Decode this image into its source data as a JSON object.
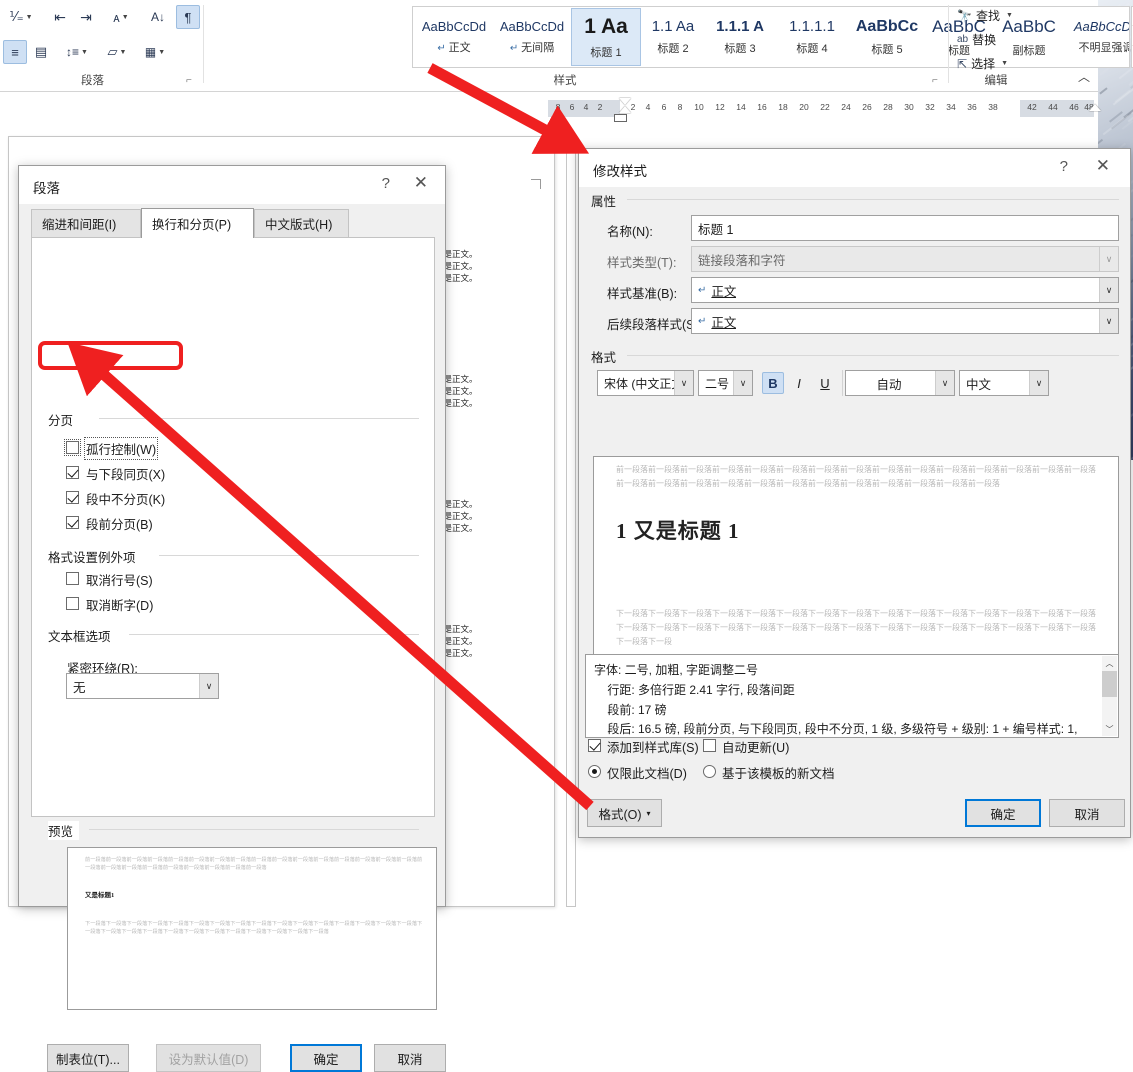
{
  "ribbon": {
    "paragraph_group": {
      "label": "段落",
      "dialog_launcher": "dialog-launcher",
      "buttons": [
        {
          "name": "multilevel-list",
          "glyph": "≔"
        },
        {
          "name": "decrease-indent",
          "glyph": "⇤"
        },
        {
          "name": "increase-indent",
          "glyph": "⇥"
        },
        {
          "name": "asian-layout",
          "glyph": "文"
        },
        {
          "name": "sort",
          "glyph": "A↓"
        },
        {
          "name": "show-formatting-marks",
          "glyph": "¶"
        },
        {
          "name": "align-left",
          "glyph": "≡"
        },
        {
          "name": "distributed",
          "glyph": "▤"
        },
        {
          "name": "line-spacing",
          "glyph": "↕"
        },
        {
          "name": "shading",
          "glyph": "▱"
        },
        {
          "name": "borders",
          "glyph": "▦"
        }
      ]
    },
    "styles_group": {
      "label": "样式",
      "dialog_launcher": "dialog-launcher",
      "items": [
        {
          "sample": "AaBbCcDd",
          "name": "正文",
          "mark": "↵",
          "size": 13,
          "weight": "400",
          "style": "normal",
          "active": false
        },
        {
          "sample": "AaBbCcDd",
          "name": "无间隔",
          "mark": "↵",
          "size": 13,
          "weight": "400",
          "style": "normal",
          "active": false
        },
        {
          "sample": "1  Aa",
          "name": "标题 1",
          "mark": "",
          "size": 21,
          "weight": "700",
          "style": "normal",
          "active": true
        },
        {
          "sample": "1.1  Aa",
          "name": "标题 2",
          "mark": "",
          "size": 15,
          "weight": "400",
          "style": "normal",
          "active": false
        },
        {
          "sample": "1.1.1  A",
          "name": "标题 3",
          "mark": "",
          "size": 15,
          "weight": "700",
          "style": "normal",
          "active": false
        },
        {
          "sample": "1.1.1.1",
          "name": "标题 4",
          "mark": "",
          "size": 15,
          "weight": "400",
          "style": "normal",
          "active": false
        },
        {
          "sample": "AaBbCc",
          "name": "标题 5",
          "mark": "",
          "size": 16,
          "weight": "700",
          "style": "normal",
          "active": false
        },
        {
          "sample": "AaBbC",
          "name": "标题",
          "mark": "",
          "size": 17,
          "weight": "400",
          "style": "normal",
          "active": false
        },
        {
          "sample": "AaBbC",
          "name": "副标题",
          "mark": "",
          "size": 17,
          "weight": "400",
          "style": "normal",
          "active": false
        },
        {
          "sample": "AaBbCcDd",
          "name": "不明显强调",
          "mark": "",
          "size": 13,
          "weight": "400",
          "style": "italic",
          "active": false
        }
      ],
      "scroll": {
        "up": "▲",
        "down": "▼",
        "more": "▼"
      }
    },
    "editing_group": {
      "label": "编辑",
      "items": [
        {
          "icon": "binoculars-icon",
          "glyph": "🔍",
          "label": "查找",
          "caret": "▾"
        },
        {
          "icon": "replace-icon",
          "glyph": "ab",
          "label": "替换",
          "caret": ""
        },
        {
          "icon": "select-icon",
          "glyph": "↖",
          "label": "选择",
          "caret": "▾"
        }
      ]
    },
    "collapse_ribbon": "︿"
  },
  "ruler": {
    "ticks": [
      "8",
      "6",
      "4",
      "2",
      "2",
      "4",
      "6",
      "8",
      "10",
      "12",
      "14",
      "16",
      "18",
      "20",
      "22",
      "24",
      "26",
      "28",
      "30",
      "32",
      "34",
      "36",
      "38",
      "42",
      "44",
      "46",
      "48"
    ]
  },
  "document": {
    "body_text": "这是正文。"
  },
  "paragraph_dialog": {
    "title": "段落",
    "help_button": "?",
    "close_button": "✕",
    "tabs": [
      {
        "label": "缩进和间距(I)",
        "active": false
      },
      {
        "label": "换行和分页(P)",
        "active": true
      },
      {
        "label": "中文版式(H)",
        "active": false
      }
    ],
    "pagination": {
      "group_label": "分页",
      "options": [
        {
          "label": "孤行控制(W)",
          "checked": false,
          "focused": true
        },
        {
          "label": "与下段同页(X)",
          "checked": true,
          "focused": false
        },
        {
          "label": "段中不分页(K)",
          "checked": true,
          "focused": false
        },
        {
          "label": "段前分页(B)",
          "checked": true,
          "focused": false,
          "highlighted": true
        }
      ]
    },
    "format_options": {
      "group_label": "格式设置例外项",
      "options": [
        {
          "label": "取消行号(S)",
          "checked": false
        },
        {
          "label": "取消断字(D)",
          "checked": false
        }
      ]
    },
    "textbox_options": {
      "group_label": "文本框选项",
      "field_label": "紧密环绕(R):",
      "value": "无"
    },
    "preview": {
      "group_label": "预览",
      "before_text": "前一段落前一段落前一段落前一段落前一段落前一段落前一段落前一段落前一段落前一段落前一段落前一段落前一段落前一段落前一段落前一段落前一段落前一段落前一段落前一段落前一段落前一段落前一段落前一段落前一段落",
      "heading_text": "又是标题1",
      "after_text": "下一段落下一段落下一段落下一段落下一段落下一段落下一段落下一段落下一段落下一段落下一段落下一段落下一段落下一段落下一段落下一段落下一段落下一段落下一段落下一段落下一段落下一段落下一段落下一段落下一段落下一段落下一段落下一段落"
    },
    "buttons": {
      "tabs_button": "制表位(T)...",
      "set_default": "设为默认值(D)",
      "ok": "确定",
      "cancel": "取消"
    }
  },
  "modify_style_dialog": {
    "title": "修改样式",
    "help_button": "?",
    "close_button": "✕",
    "properties": {
      "group_label": "属性",
      "name_label": "名称(N):",
      "name_value": "标题 1",
      "type_label": "样式类型(T):",
      "type_value": "链接段落和字符",
      "basedon_label": "样式基准(B):",
      "basedon_value": "正文",
      "basedon_mark": "↵",
      "next_label": "后续段落样式(S):",
      "next_value": "正文",
      "next_mark": "↵"
    },
    "format": {
      "group_label": "格式",
      "font_family": "宋体 (中文正文",
      "font_size": "二号",
      "bold": "B",
      "italic": "I",
      "underline": "U",
      "font_color": "自动",
      "language": "中文",
      "bold_on": true,
      "align_buttons": [
        "align-left",
        "align-center",
        "align-right",
        "align-justify"
      ],
      "align_active_index": 3,
      "spacing_buttons": [
        "line-spacing-1",
        "line-spacing-1-5",
        "line-spacing-2"
      ],
      "para_spacing_buttons": [
        "increase-space-before",
        "decrease-space-after"
      ],
      "indent_buttons": [
        "decrease-indent",
        "increase-indent"
      ]
    },
    "preview": {
      "before_text": "前一段落前一段落前一段落前一段落前一段落前一段落前一段落前一段落前一段落前一段落前一段落前一段落前一段落前一段落前一段落前一段落前一段落前一段落前一段落前一段落前一段落前一段落前一段落前一段落前一段落前一段落前一段落",
      "heading_text": "1 又是标题 1",
      "after_text": "下一段落下一段落下一段落下一段落下一段落下一段落下一段落下一段落下一段落下一段落下一段落下一段落下一段落下一段落下一段落下一段落下一段落下一段落下一段落下一段落下一段落下一段落下一段落下一段落下一段落下一段落下一段落下一段落下一段落下一段落下一段落下一段"
    },
    "description": [
      "字体: 二号, 加粗, 字距调整二号",
      "    行距: 多倍行距 2.41 字行, 段落间距",
      "    段前: 17 磅",
      "    段后: 16.5 磅, 段前分页, 与下段同页, 段中不分页, 1 级, 多级符号 + 级别: 1 + 编号样式: 1,"
    ],
    "checkboxes": [
      {
        "label": "添加到样式库(S)",
        "checked": true
      },
      {
        "label": "自动更新(U)",
        "checked": false
      }
    ],
    "radios": [
      {
        "label": "仅限此文档(D)",
        "checked": true
      },
      {
        "label": "基于该模板的新文档",
        "checked": false
      }
    ],
    "buttons": {
      "format": "格式(O)",
      "format_caret": "▾",
      "ok": "确定",
      "cancel": "取消"
    },
    "scrollbar": {
      "up": "︿",
      "down": "﹀"
    }
  },
  "annotations": {
    "accent_color": "#ef2020",
    "arrow_1": "points from 标题 1 style button to 修改样式 dialog",
    "arrow_2": "points from 格式(O) button to 段前分页(B) checkbox",
    "highlight_rect": "段前分页(B) checkbox highlighted"
  }
}
